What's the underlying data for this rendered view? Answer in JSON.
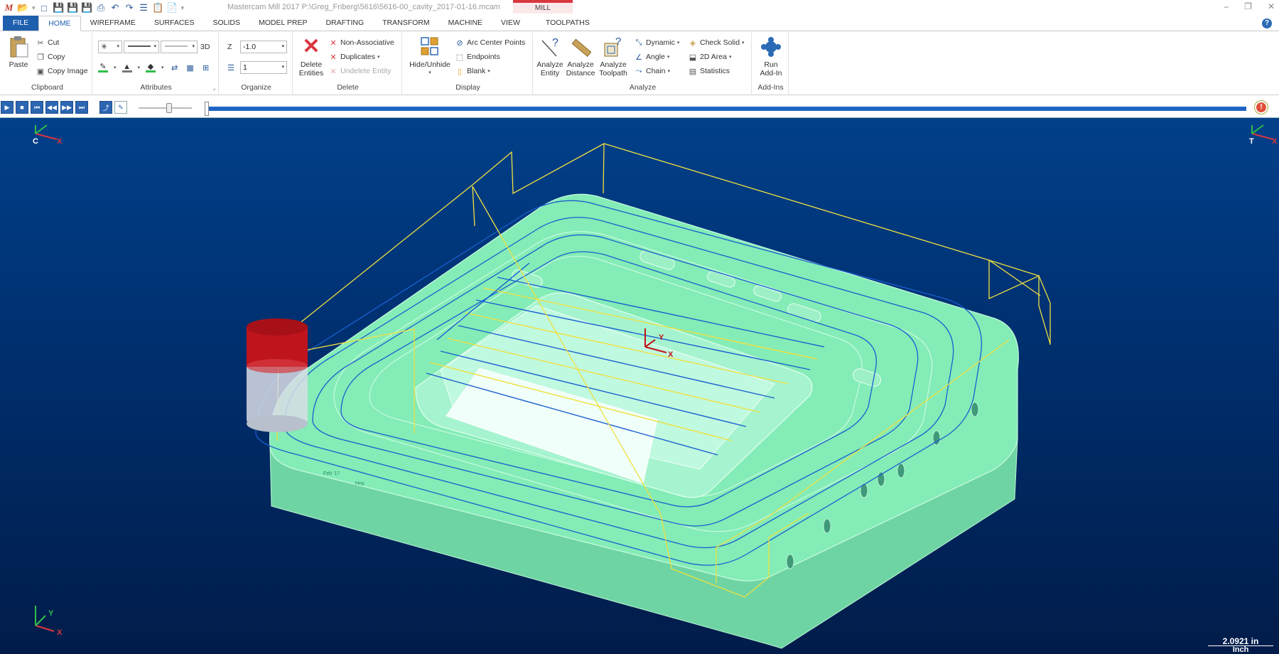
{
  "titlebar": {
    "title": "Mastercam Mill 2017  P:\\Greg_Friberg\\5616\\5616-00_cavity_2017-01-16.mcam",
    "context_tab": "MILL",
    "quick_access": [
      "logo",
      "open",
      "save",
      "save-as",
      "save-all",
      "print",
      "undo",
      "redo",
      "levels",
      "paste-clipboard",
      "copy-doc",
      "dropdown"
    ]
  },
  "tabs": [
    {
      "label": "FILE"
    },
    {
      "label": "HOME"
    },
    {
      "label": "WIREFRAME"
    },
    {
      "label": "SURFACES"
    },
    {
      "label": "SOLIDS"
    },
    {
      "label": "MODEL PREP"
    },
    {
      "label": "DRAFTING"
    },
    {
      "label": "TRANSFORM"
    },
    {
      "label": "MACHINE"
    },
    {
      "label": "VIEW"
    },
    {
      "label": "TOOLPATHS"
    }
  ],
  "ribbon": {
    "clipboard": {
      "label": "Clipboard",
      "paste": "Paste",
      "cut": "Cut",
      "copy": "Copy",
      "copy_image": "Copy Image"
    },
    "attributes": {
      "label": "Attributes",
      "mode_3d": "3D"
    },
    "organize": {
      "label": "Organize",
      "z_label": "Z",
      "z_value": "-1.0",
      "level_value": "1"
    },
    "delete": {
      "label": "Delete",
      "delete_entities": "Delete Entities",
      "delete_entities_l1": "Delete",
      "delete_entities_l2": "Entities",
      "non_associative": "Non-Associative",
      "duplicates": "Duplicates",
      "undelete": "Undelete Entity"
    },
    "display": {
      "label": "Display",
      "hide_unhide": "Hide/Unhide",
      "arc_center_points": "Arc Center Points",
      "endpoints": "Endpoints",
      "blank": "Blank"
    },
    "analyze": {
      "label": "Analyze",
      "entity_l1": "Analyze",
      "entity_l2": "Entity",
      "distance_l1": "Analyze",
      "distance_l2": "Distance",
      "toolpath_l1": "Analyze",
      "toolpath_l2": "Toolpath",
      "dynamic": "Dynamic",
      "angle": "Angle",
      "chain": "Chain",
      "check_solid": "Check Solid",
      "area_2d": "2D Area",
      "statistics": "Statistics"
    },
    "addins": {
      "label": "Add-Ins",
      "run_l1": "Run",
      "run_l2": "Add-In"
    }
  },
  "viewport": {
    "gview_top_left": {
      "c": "C",
      "x": "X"
    },
    "gview_top_right": {
      "t": "T",
      "x": "X"
    },
    "origin_axes": {
      "x": "X",
      "y": "Y"
    },
    "world_axes": {
      "x": "X",
      "y": "Y"
    },
    "scale_value": "2.0921 in",
    "scale_unit": "Inch",
    "part_engravings": [
      "Feb '17",
      "Hnp"
    ],
    "colors": {
      "part": "#7ee7b0",
      "toolpath_blue": "#1a5fd0",
      "rapid_yellow": "#f0e040",
      "tool_red": "#c0141c",
      "background": "#002f6c"
    }
  }
}
